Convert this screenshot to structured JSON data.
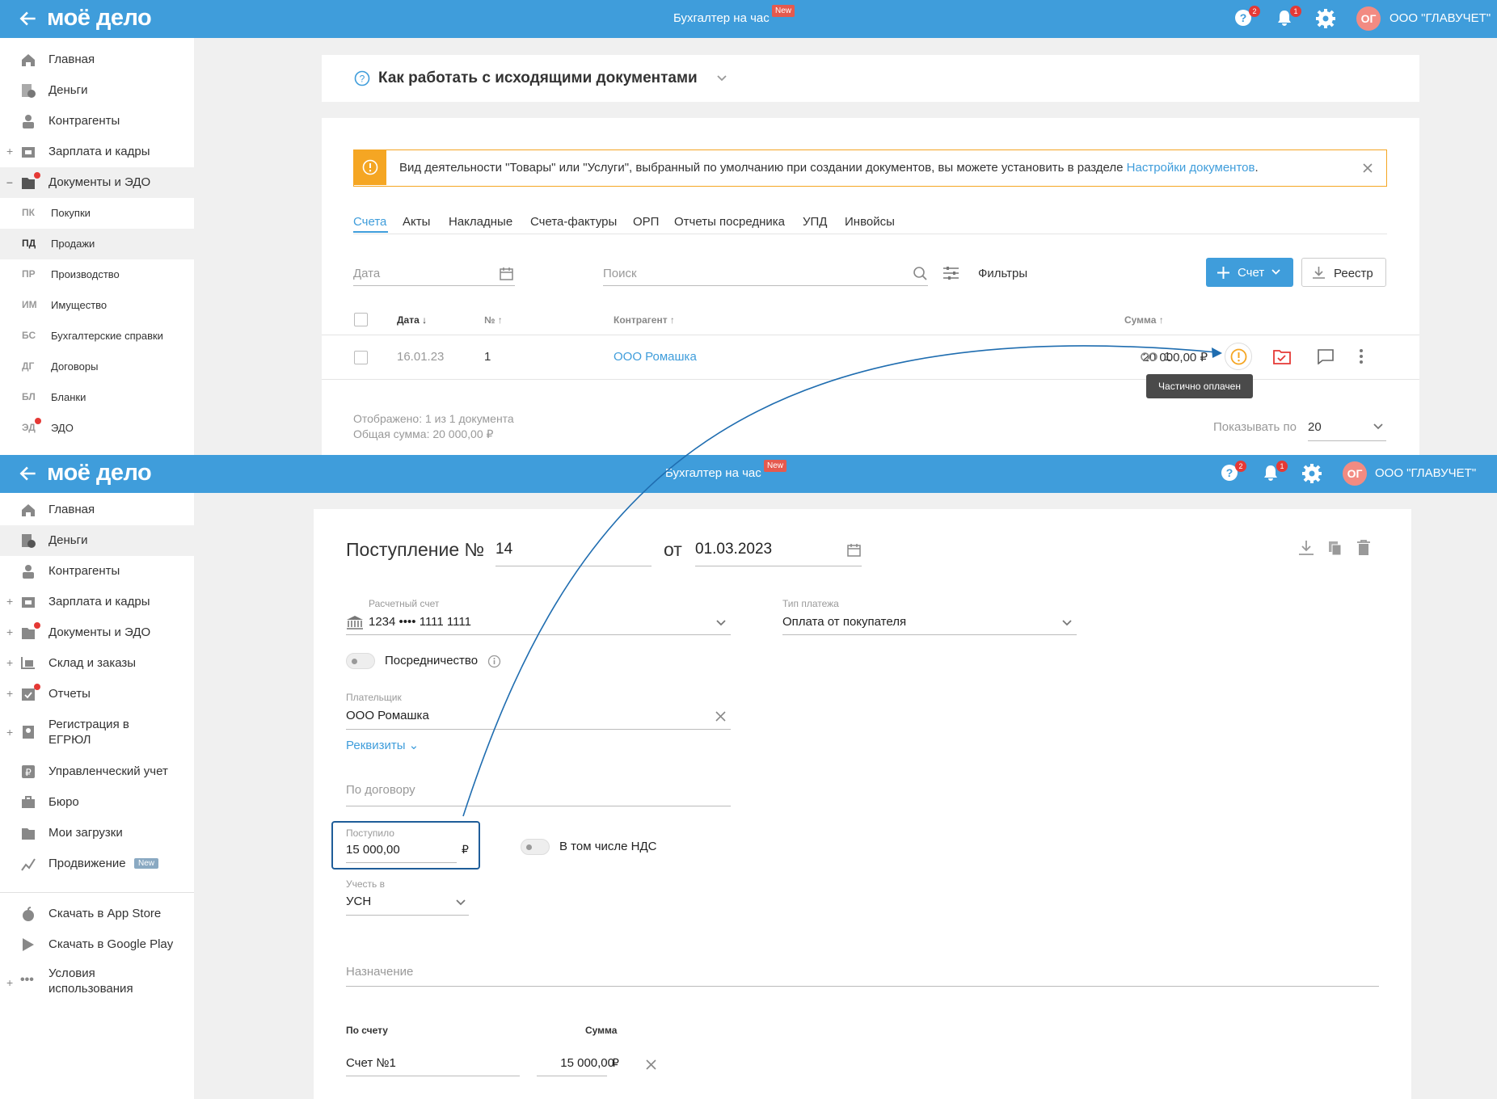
{
  "top": {
    "logo": "моё дело",
    "center_title": "Бухгалтер на час",
    "new_badge": "New",
    "help_count": "2",
    "notif_count": "1",
    "avatar": "ОГ",
    "org": "ООО \"ГЛАВУЧЕТ\""
  },
  "sidebar1": {
    "items": [
      {
        "label": "Главная",
        "icon": "home-icon"
      },
      {
        "label": "Деньги",
        "icon": "money-icon"
      },
      {
        "label": "Контрагенты",
        "icon": "contractors-icon"
      },
      {
        "label": "Зарплата и кадры",
        "icon": "salary-icon"
      },
      {
        "label": "Документы и ЭДО",
        "icon": "documents-icon"
      }
    ],
    "subitems": [
      {
        "abbr": "ПК",
        "label": "Покупки"
      },
      {
        "abbr": "ПД",
        "label": "Продажи"
      },
      {
        "abbr": "ПР",
        "label": "Производство"
      },
      {
        "abbr": "ИМ",
        "label": "Имущество"
      },
      {
        "abbr": "БС",
        "label": "Бухгалтерские справки"
      },
      {
        "abbr": "ДГ",
        "label": "Договоры"
      },
      {
        "abbr": "БЛ",
        "label": "Бланки"
      },
      {
        "abbr": "ЭД",
        "label": "ЭДО"
      }
    ]
  },
  "help_card": {
    "title": "Как работать с исходящими документами"
  },
  "notice": {
    "text": "Вид деятельности \"Товары\" или \"Услуги\", выбранный по умолчанию при создании документов, вы можете установить в разделе ",
    "link": "Настройки документов",
    "end": "."
  },
  "tabs": [
    "Счета",
    "Акты",
    "Накладные",
    "Счета-фактуры",
    "ОРП",
    "Отчеты посредника",
    "УПД",
    "Инвойсы"
  ],
  "filters": {
    "date_placeholder": "Дата",
    "search_placeholder": "Поиск",
    "filters_label": "Фильтры",
    "invoice_button": "Счет",
    "registry_button": "Реестр"
  },
  "table": {
    "headers": {
      "date": "Дата",
      "number": "№",
      "contractor": "Контрагент",
      "sum": "Сумма"
    },
    "rows": [
      {
        "date": "16.01.23",
        "number": "1",
        "contractor": "ООО Ромашка",
        "sum": "20 000,00 ₽",
        "link_count": "1"
      }
    ],
    "tooltip": "Частично оплачен"
  },
  "footer": {
    "shown": "Отображено: 1 из 1 документа",
    "total": "Общая сумма: 20 000,00 ₽",
    "per_page_label": "Показывать по",
    "per_page_value": "20"
  },
  "sidebar2": {
    "items": [
      {
        "label": "Главная",
        "icon": "home-icon"
      },
      {
        "label": "Деньги",
        "icon": "money-icon"
      },
      {
        "label": "Контрагенты",
        "icon": "contractors-icon"
      },
      {
        "label": "Зарплата и кадры",
        "icon": "salary-icon"
      },
      {
        "label": "Документы и ЭДО",
        "icon": "documents-icon"
      },
      {
        "label": "Склад и заказы",
        "icon": "warehouse-icon"
      },
      {
        "label": "Отчеты",
        "icon": "reports-icon"
      },
      {
        "label": "Регистрация в",
        "label2": "ЕГРЮЛ",
        "icon": "registration-icon"
      },
      {
        "label": "Управленческий учет",
        "icon": "management-icon"
      },
      {
        "label": "Бюро",
        "icon": "bureau-icon"
      },
      {
        "label": "Мои загрузки",
        "icon": "downloads-icon"
      },
      {
        "label": "Продвижение",
        "icon": "promotion-icon",
        "badge": "New"
      },
      {
        "label": "Скачать в App Store",
        "icon": "apple-icon"
      },
      {
        "label": "Скачать в Google Play",
        "icon": "google-play-icon"
      },
      {
        "label": "Условия",
        "label2": "использования",
        "icon": "more-icon"
      }
    ]
  },
  "form": {
    "title": "Поступление №",
    "number": "14",
    "from": "от",
    "date": "01.03.2023",
    "account_label": "Расчетный счет",
    "account_value": "1234 •••• 1111 1111",
    "payment_type_label": "Тип платежа",
    "payment_type_value": "Оплата от покупателя",
    "mediation": "Посредничество",
    "payer_label": "Плательщик",
    "payer_value": "ООО Ромашка",
    "requisites": "Реквизиты",
    "contract_placeholder": "По договору",
    "received_label": "Поступило",
    "received_value": "15 000,00",
    "currency": "₽",
    "vat_label": "В том числе НДС",
    "account_in_label": "Учесть в",
    "account_in_value": "УСН",
    "purpose_placeholder": "Назначение",
    "by_invoice_header": "По счету",
    "sum_header": "Сумма",
    "invoice_value": "Счет №1",
    "invoice_sum": "15 000,00"
  },
  "colors": {
    "accent": "#3f9ddb",
    "warning": "#f5a623",
    "danger": "#e53935"
  }
}
